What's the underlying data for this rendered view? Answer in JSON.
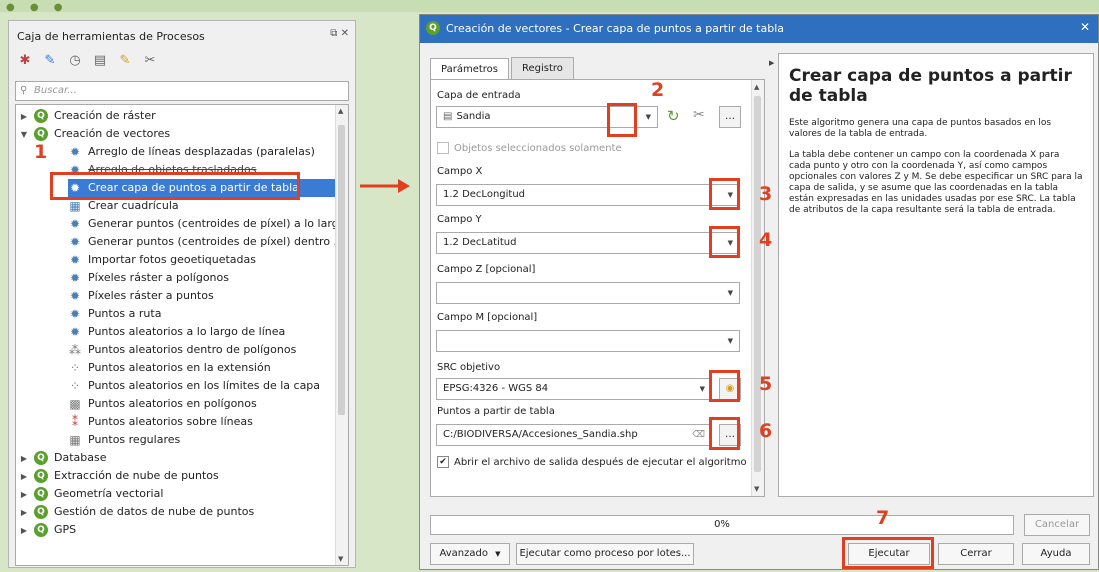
{
  "toolbox": {
    "title": "Caja de herramientas de Procesos",
    "search_placeholder": "Buscar...",
    "groups": {
      "raster": "Creación de ráster",
      "vector": "Creación de vectores",
      "database": "Database",
      "pointcloud": "Extracción de nube de puntos",
      "geometry": "Geometría vectorial",
      "pcmgmt": "Gestión de datos de nube de puntos",
      "gps": "GPS"
    },
    "items": [
      "Arreglo de líneas desplazadas (paralelas)",
      "Arreglo de objetos trasladados",
      "Crear capa de puntos a partir de tabla",
      "Crear cuadrícula",
      "Generar puntos (centroides de píxel) a lo larg...",
      "Generar puntos (centroides de píxel) dentro ...",
      "Importar fotos geoetiquetadas",
      "Píxeles ráster a polígonos",
      "Píxeles ráster a puntos",
      "Puntos a ruta",
      "Puntos aleatorios a lo largo de línea",
      "Puntos aleatorios dentro de polígonos",
      "Puntos aleatorios en la extensión",
      "Puntos aleatorios en los límites de la capa",
      "Puntos aleatorios en polígonos",
      "Puntos aleatorios sobre líneas",
      "Puntos regulares"
    ]
  },
  "dialog": {
    "title": "Creación de vectores - Crear capa de puntos a partir de tabla",
    "tabs": [
      "Parámetros",
      "Registro"
    ],
    "input_layer_label": "Capa de entrada",
    "input_layer_value": "Sandia",
    "selected_only_label": "Objetos seleccionados solamente",
    "field_x_label": "Campo X",
    "field_x_value": "1.2 DecLongitud",
    "field_y_label": "Campo Y",
    "field_y_value": "1.2 DecLatitud",
    "field_z_label": "Campo Z [opcional]",
    "field_m_label": "Campo M [opcional]",
    "crs_label": "SRC objetivo",
    "crs_value": "EPSG:4326 - WGS 84",
    "output_label": "Puntos a partir de tabla",
    "output_value": "C:/BIODIVERSA/Accesiones_Sandia.shp",
    "open_output_label": "Abrir el archivo de salida después de ejecutar el algoritmo",
    "help_title": "Crear capa de puntos a partir de tabla",
    "help_p1": "Este algoritmo genera una capa de puntos basados en los valores de la tabla de entrada.",
    "help_p2": "La tabla debe contener un campo con la coordenada X para cada punto y otro con la coordenada Y, así como campos opcionales con valores Z y M. Se debe especificar un SRC para la capa de salida, y se asume que las coordenadas en la tabla están expresadas en las unidades usadas por ese SRC. La tabla de atributos de la capa resultante será la tabla de entrada.",
    "progress": "0%",
    "cancel": "Cancelar",
    "advanced": "Avanzado",
    "batch": "Ejecutar como proceso por lotes...",
    "run": "Ejecutar",
    "close": "Cerrar",
    "help": "Ayuda"
  },
  "annotations": [
    "1",
    "2",
    "3",
    "4",
    "5",
    "6",
    "7"
  ],
  "colors": {
    "highlight": "#e04020",
    "selection": "#3a7bd5",
    "titlebar": "#2f6fc0"
  }
}
